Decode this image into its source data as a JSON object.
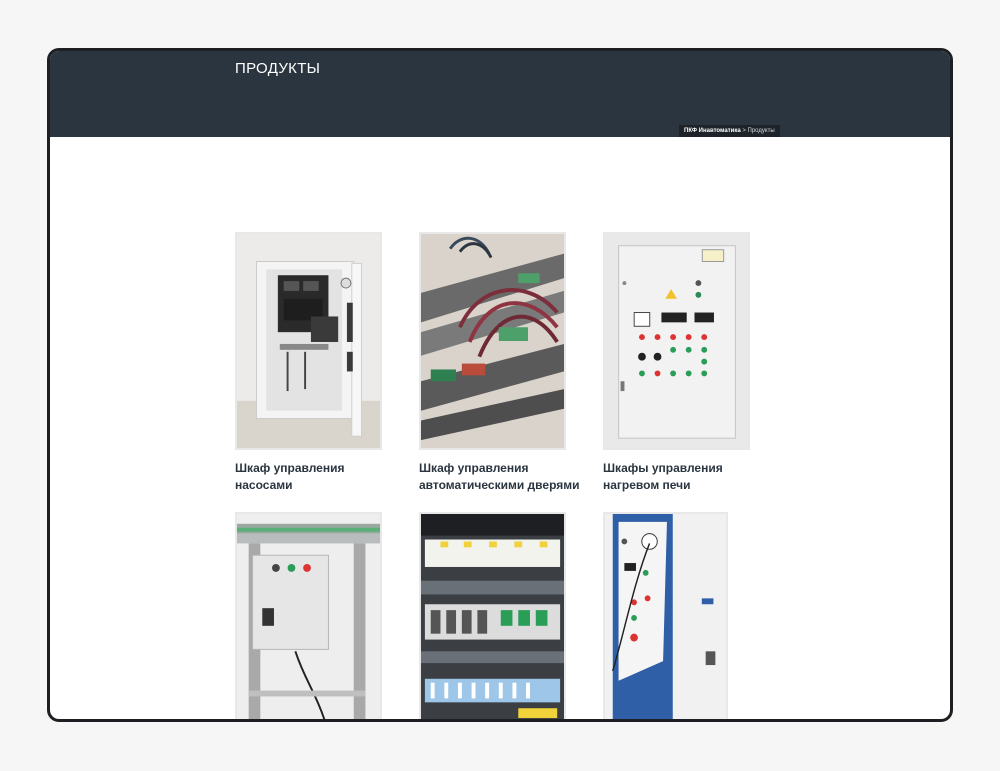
{
  "header": {
    "title": "ПРОДУКТЫ",
    "breadcrumb": {
      "home": "ПКФ Инавтоматика",
      "separator": " > ",
      "current": "Продукты"
    }
  },
  "products": [
    {
      "title": "Шкаф управления насосами"
    },
    {
      "title": "Шкаф управления автоматическими дверями"
    },
    {
      "title": "Шкафы управления нагревом печи"
    },
    {
      "title": ""
    },
    {
      "title": ""
    },
    {
      "title": ""
    }
  ],
  "colors": {
    "header_bg": "#2b353f",
    "breadcrumb_bg": "#1d2329",
    "title_text": "#2b3540"
  }
}
